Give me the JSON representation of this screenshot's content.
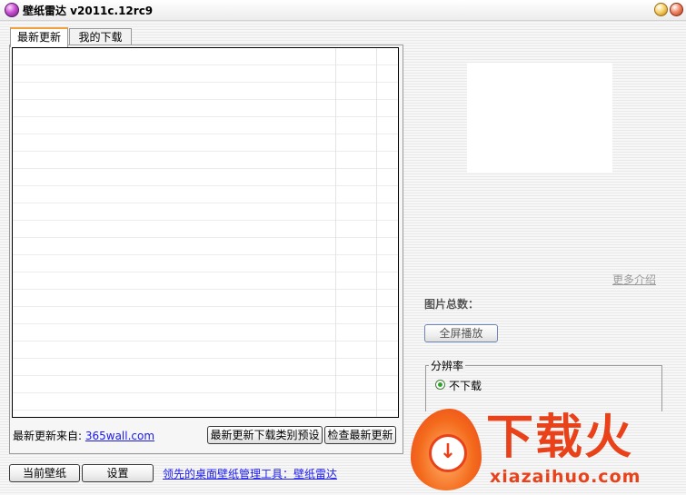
{
  "window": {
    "title": "壁纸雷达 v2011c.12rc9"
  },
  "tabs": [
    {
      "label": "最新更新",
      "active": true
    },
    {
      "label": "我的下载",
      "active": false
    }
  ],
  "source": {
    "label": "最新更新来自: ",
    "link_text": "365wall.com"
  },
  "panel_buttons": {
    "preset_label": "最新更新下载类别预设",
    "check_label": "检查最新更新"
  },
  "bottom_bar": {
    "current_label": "当前壁纸",
    "settings_label": "设置",
    "slogan": "领先的桌面壁纸管理工具：壁纸雷达"
  },
  "right_panel": {
    "more_link": "更多介绍",
    "total_label": "图片总数：",
    "fullscreen_label": "全屏播放",
    "resolution": {
      "legend": "分辨率",
      "selected_option": "不下载"
    }
  },
  "watermark": {
    "title": "下载火",
    "domain": "xiazaihuo.com"
  },
  "colors": {
    "accent": "#f2a23c",
    "link": "#1a1aee",
    "brand": "#e9421a"
  }
}
